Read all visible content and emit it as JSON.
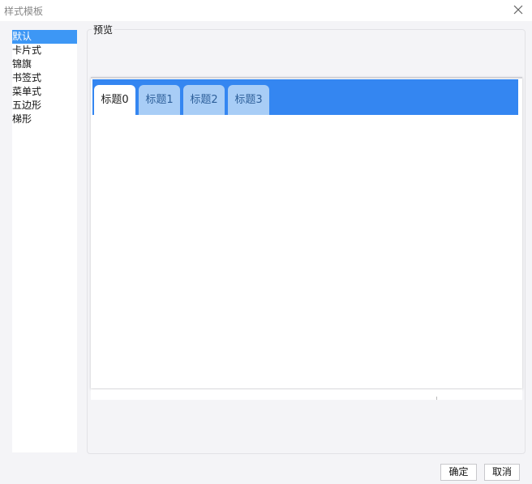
{
  "window": {
    "title": "样式模板",
    "close_icon": "close-icon"
  },
  "template_list": {
    "items": [
      {
        "label": "默认",
        "selected": true
      },
      {
        "label": "卡片式",
        "selected": false
      },
      {
        "label": "锦旗",
        "selected": false
      },
      {
        "label": "书签式",
        "selected": false
      },
      {
        "label": "菜单式",
        "selected": false
      },
      {
        "label": "五边形",
        "selected": false
      },
      {
        "label": "梯形",
        "selected": false
      }
    ]
  },
  "preview": {
    "label": "预览",
    "tabbar_color": "#3486f1",
    "tabs": [
      {
        "label": "标题0",
        "active": true
      },
      {
        "label": "标题1",
        "active": false
      },
      {
        "label": "标题2",
        "active": false
      },
      {
        "label": "标题3",
        "active": false
      }
    ]
  },
  "buttons": {
    "ok": "确定",
    "cancel": "取消"
  },
  "colors": {
    "selection": "#3d97f5",
    "inactive_tab": "#a8cdf6"
  }
}
